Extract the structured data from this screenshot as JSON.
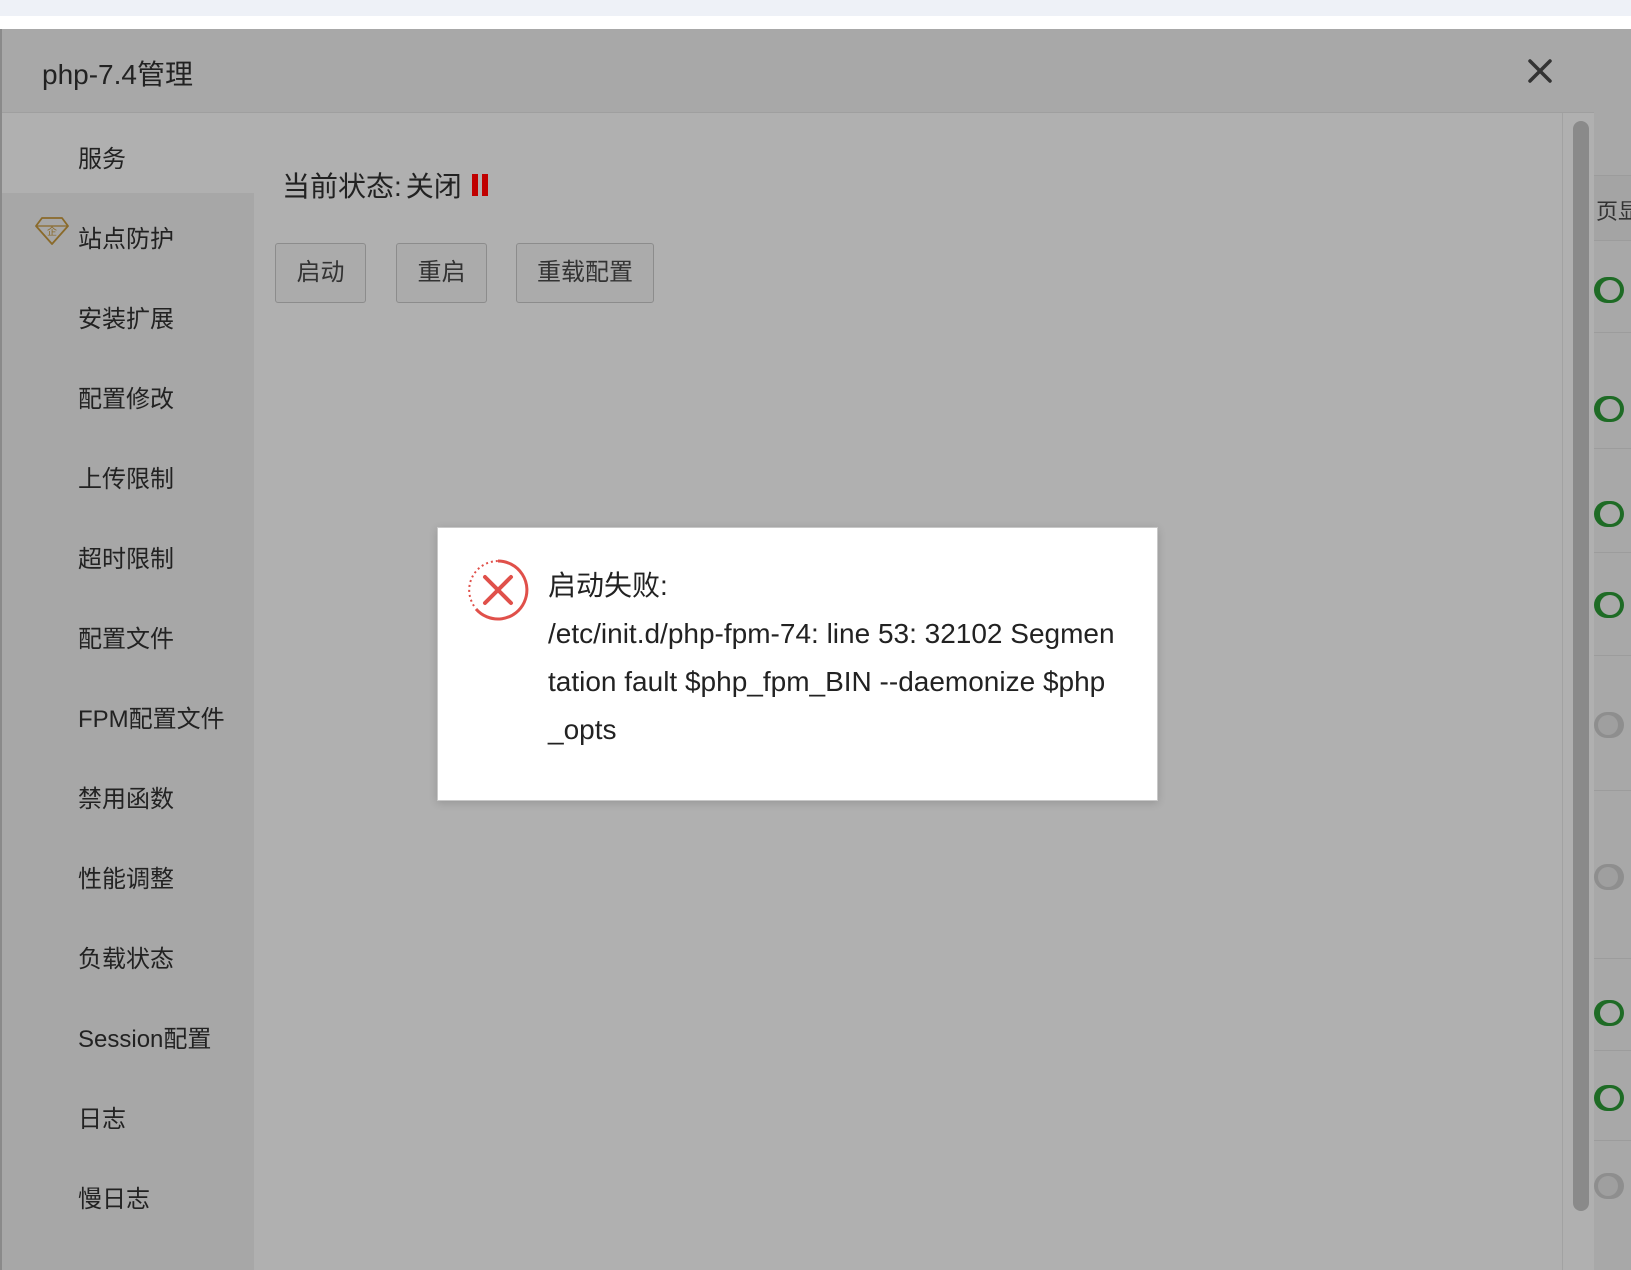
{
  "modal": {
    "title": "php-7.4管理"
  },
  "sidebar": {
    "items": [
      {
        "label": "服务",
        "active": true
      },
      {
        "label": "站点防护",
        "icon": "enterprise-gem-icon"
      },
      {
        "label": "安装扩展"
      },
      {
        "label": "配置修改"
      },
      {
        "label": "上传限制"
      },
      {
        "label": "超时限制"
      },
      {
        "label": "配置文件"
      },
      {
        "label": "FPM配置文件"
      },
      {
        "label": "禁用函数"
      },
      {
        "label": "性能调整"
      },
      {
        "label": "负载状态"
      },
      {
        "label": "Session配置"
      },
      {
        "label": "日志"
      },
      {
        "label": "慢日志"
      }
    ],
    "gem_glyph": "企"
  },
  "service": {
    "status_label": "当前状态:",
    "status_value": "关闭",
    "status_color": "#c00000",
    "buttons": {
      "start": "启动",
      "restart": "重启",
      "reload": "重载配置"
    }
  },
  "dialog": {
    "icon": "error-circle-icon",
    "icon_color": "#e0504a",
    "lines": [
      "启动失败:",
      "/etc/init.d/php-fpm-74: line 53: 32102 Segmen",
      "tation fault $php_fpm_BIN --daemonize $php",
      "_opts"
    ]
  },
  "background": {
    "header_text": "页显",
    "toggle_on_color": "#1e6b25"
  }
}
